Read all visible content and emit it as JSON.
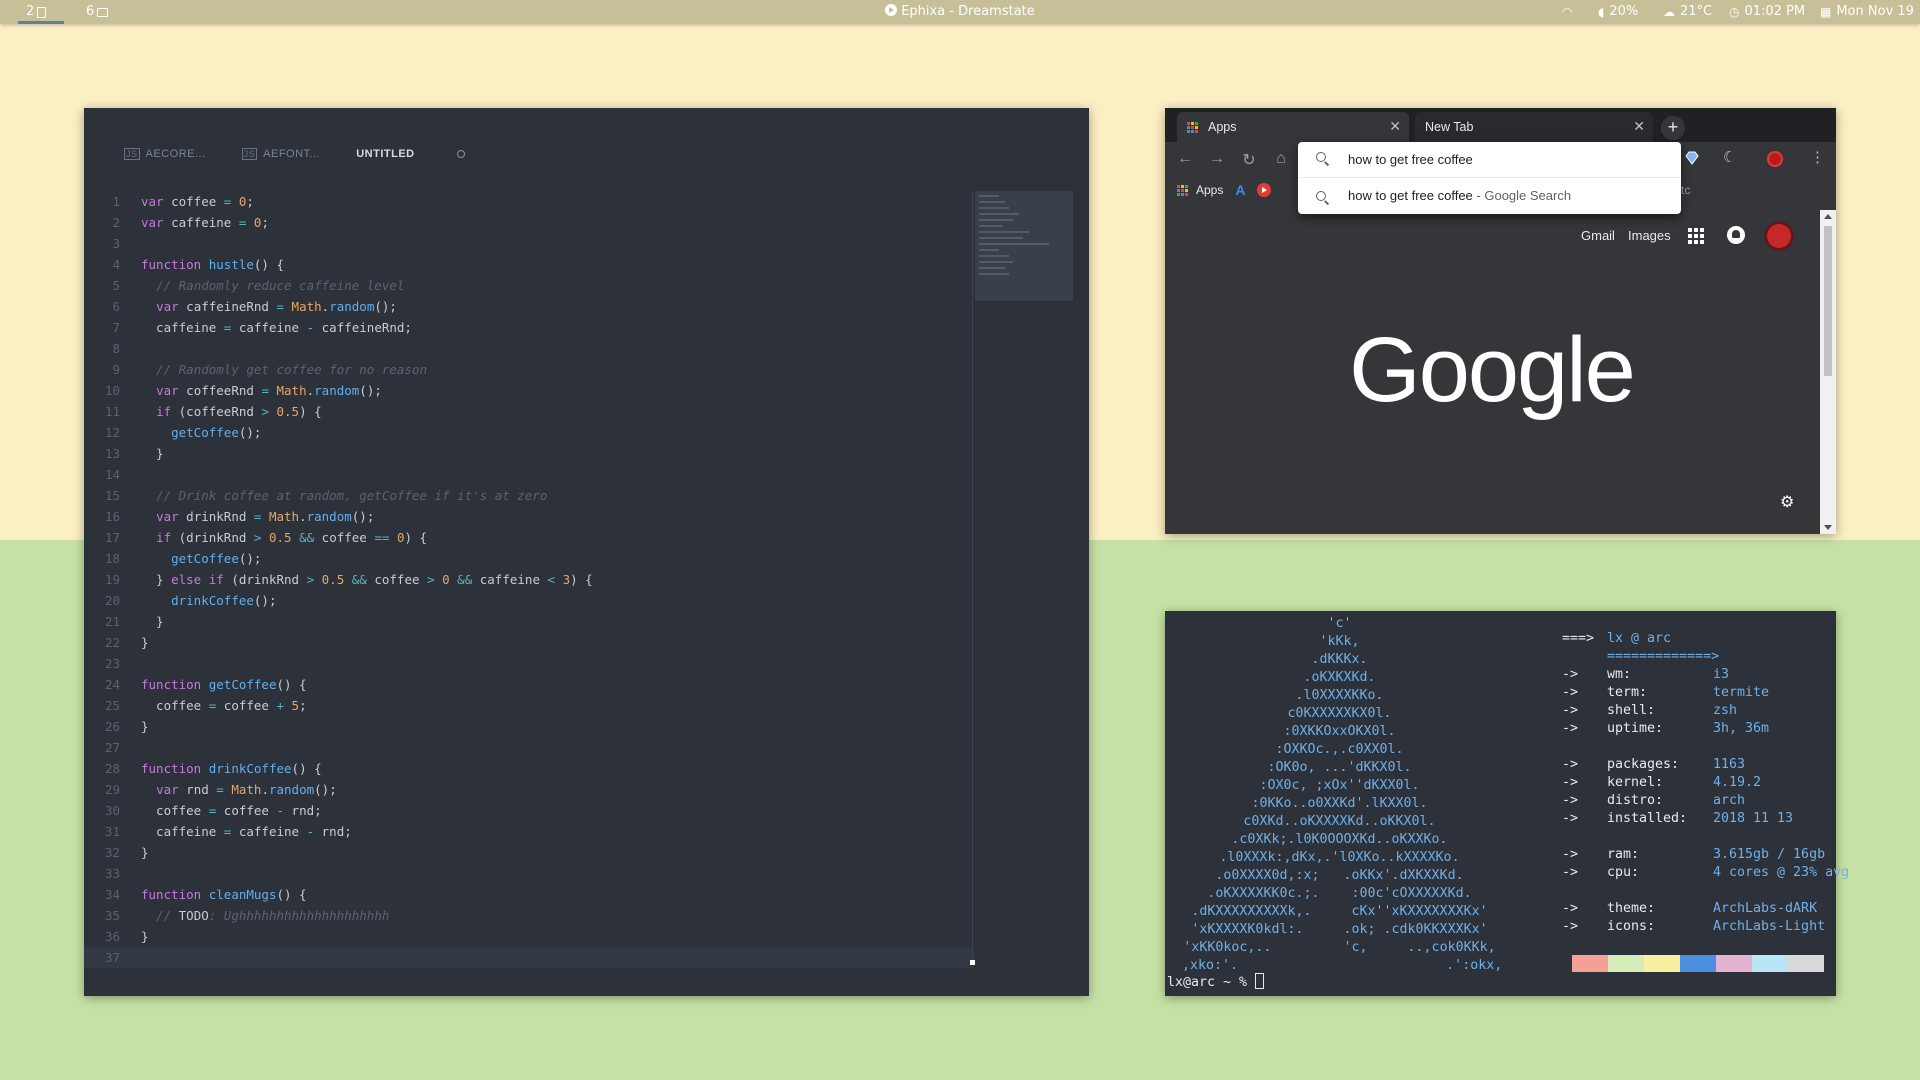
{
  "topbar": {
    "workspaces": [
      {
        "label": "2",
        "icon": "document-icon"
      },
      {
        "label": "6",
        "icon": "folder-icon"
      }
    ],
    "now_playing": "Ephixa - Dreamstate",
    "volume": "20%",
    "weather": "21°C",
    "time": "01:02 PM",
    "date": "Mon Nov 19"
  },
  "editor": {
    "tabs": [
      {
        "label": "AECORE..."
      },
      {
        "label": "AEFONT..."
      },
      {
        "label": "UNTITLED"
      }
    ],
    "current_line": 37
  },
  "browser": {
    "tabs": [
      {
        "label": "Apps"
      },
      {
        "label": "New Tab"
      }
    ],
    "omnibox_value": "how to get free coffee",
    "suggestion_query": "how to get free coffee",
    "suggestion_suffix": " - Google Search",
    "bookmarks": {
      "apps": "Apps",
      "clipped": "tc"
    },
    "links": {
      "gmail": "Gmail",
      "images": "Images"
    },
    "logo": "Google"
  },
  "terminal": {
    "ascii": [
      "'c'",
      "'kKk,",
      ".dKKKx.",
      ".oKXKXKd.",
      ".l0XXXXKKo.",
      "c0KXXXXXKX0l.",
      ":0XKKOxxOKX0l.",
      ":OXKOc.,.c0XX0l.",
      ":OK0o, ...'dKKX0l.",
      ":OX0c, ;xOx''dKXX0l.",
      ":0KKo..o0XXKd'.lKXX0l.",
      "c0XKd..oKXXXXKd..oKKX0l.",
      ".c0XKk;.l0K0OOOXKd..oKXXKo.",
      ".l0XXXk:,dKx,.'l0XKo..kXXXXKo.",
      ".o0XXXX0d,:x;   .oKKx'.dXKXXKd.",
      ".oKXXXXKK0c.;.    :00c'cOXXXXXKd.",
      ".dKXXXXXXXXXk,.     cKx''xKXXXXXXXKx'",
      "'xKXXXXK0kdl:.     .ok; .cdk0KKXXXKx'",
      "'xKK0koc,..         'c,     ..,cok0KKk,",
      ",xko:'.                          .':okx,"
    ],
    "info": [
      {
        "arrow": "===>",
        "key": "",
        "value": "lx @ arc"
      },
      {
        "arrow": "",
        "key": "",
        "value": "=============>"
      },
      {
        "arrow": "->",
        "key": "wm:",
        "value": "i3"
      },
      {
        "arrow": "->",
        "key": "term:",
        "value": "termite"
      },
      {
        "arrow": "->",
        "key": "shell:",
        "value": "zsh"
      },
      {
        "arrow": "->",
        "key": "uptime:",
        "value": "3h, 36m"
      },
      {
        "arrow": "",
        "key": "",
        "value": ""
      },
      {
        "arrow": "->",
        "key": "packages:",
        "value": "1163"
      },
      {
        "arrow": "->",
        "key": "kernel:",
        "value": "4.19.2"
      },
      {
        "arrow": "->",
        "key": "distro:",
        "value": "arch"
      },
      {
        "arrow": "->",
        "key": "installed:",
        "value": "2018 11 13"
      },
      {
        "arrow": "",
        "key": "",
        "value": ""
      },
      {
        "arrow": "->",
        "key": "ram:",
        "value": "3.615gb / 16gb"
      },
      {
        "arrow": "->",
        "key": "cpu:",
        "value": "4 cores @ 23% avg"
      },
      {
        "arrow": "",
        "key": "",
        "value": ""
      },
      {
        "arrow": "->",
        "key": "theme:",
        "value": "ArchLabs-dARK"
      },
      {
        "arrow": "->",
        "key": "icons:",
        "value": "ArchLabs-Light"
      }
    ],
    "palette": [
      "#f4a095",
      "#d6ecb8",
      "#f6f0a0",
      "#4c8ee0",
      "#e3b3d0",
      "#b8e6f5",
      "#d9d9d9"
    ],
    "prompt": "lx@arc ~ % "
  },
  "colors": {
    "desk_top": "#fcefc4",
    "desk_bottom": "#c6e1a5",
    "topbar": "#c7bf97",
    "editor_bg": "#2c313a",
    "browser_bg": "#35363a",
    "terminal_bg": "#2d3139"
  }
}
